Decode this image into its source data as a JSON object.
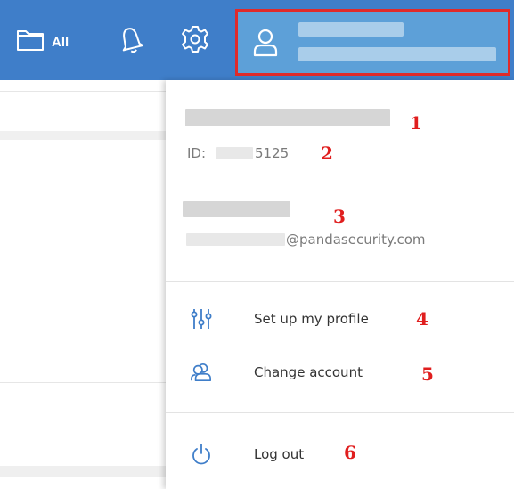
{
  "topbar": {
    "folder_label": "All"
  },
  "profile": {
    "id_label": "ID:",
    "id_suffix": "5125",
    "email_suffix": "@pandasecurity.com"
  },
  "menu": {
    "setup_profile_label": "Set up my profile",
    "change_account_label": "Change account",
    "logout_label": "Log out"
  },
  "callouts": [
    "1",
    "2",
    "3",
    "4",
    "5",
    "6"
  ],
  "colors": {
    "topbar": "#3f7ec9",
    "highlight_border": "#e02a2a",
    "callout": "#e01e1e",
    "icon_blue": "#3f7ec9"
  }
}
